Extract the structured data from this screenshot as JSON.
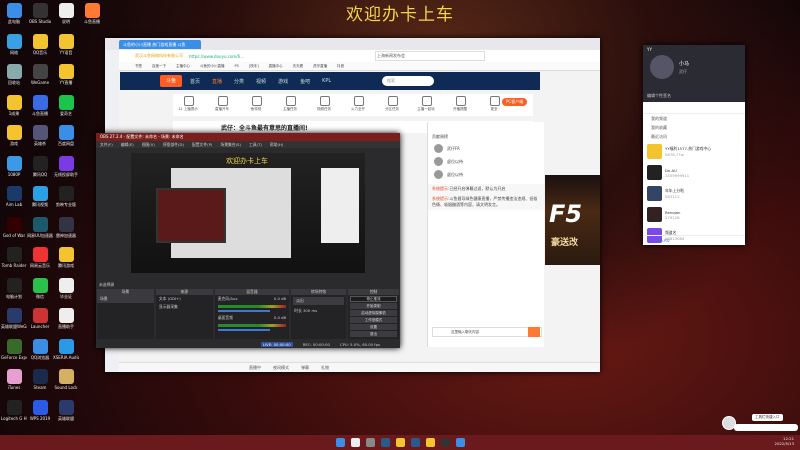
{
  "banner": "欢迎办卡上车",
  "desktop_icons": [
    {
      "label": "此电脑",
      "color": "#3a8ee6"
    },
    {
      "label": "OBS Studio",
      "color": "#333"
    },
    {
      "label": "说明",
      "color": "#eee"
    },
    {
      "label": "斗鱼直播",
      "color": "#ff7a30"
    },
    {
      "label": "网络",
      "color": "#3aa0e6"
    },
    {
      "label": "QQ音乐",
      "color": "#f4c430"
    },
    {
      "label": "YY语音",
      "color": "#f4c430"
    },
    {
      "label": "回收站",
      "color": "#8aa"
    },
    {
      "label": "WeGame",
      "color": "#444"
    },
    {
      "label": "YY直播",
      "color": "#f4c430"
    },
    {
      "label": "1成果",
      "color": "#f4c430"
    },
    {
      "label": "斗鱼直播",
      "color": "#3a6ae6"
    },
    {
      "label": "爱奇艺",
      "color": "#1bc44a"
    },
    {
      "label": "游戏",
      "color": "#f4c430"
    },
    {
      "label": "英雄杀",
      "color": "#557"
    },
    {
      "label": "百度网盘",
      "color": "#3a8ee6"
    },
    {
      "label": "1080P",
      "color": "#3a9ae6"
    },
    {
      "label": "腾讯QQ",
      "color": "#222"
    },
    {
      "label": "无线投屏助手",
      "color": "#7a3ae6"
    },
    {
      "label": "Aim Lab",
      "color": "#1a3a6a"
    },
    {
      "label": "腾讯视频",
      "color": "#2aa0e6"
    },
    {
      "label": "剪映专业版",
      "color": "#222"
    },
    {
      "label": "God of War",
      "color": "#300"
    },
    {
      "label": "网易UU加速器",
      "color": "#1a5a6a"
    },
    {
      "label": "雷神加速器",
      "color": "#334"
    },
    {
      "label": "Tomb Raider",
      "color": "#222"
    },
    {
      "label": "网易云音乐",
      "color": "#e33"
    },
    {
      "label": "腾讯游戏",
      "color": "#f4c430"
    },
    {
      "label": "电脑计划",
      "color": "#222"
    },
    {
      "label": "微信",
      "color": "#2ac04a"
    },
    {
      "label": "毕业证",
      "color": "#eee"
    },
    {
      "label": "英雄联盟WeGame版",
      "color": "#2a3a6a"
    },
    {
      "label": "Launcher",
      "color": "#c33"
    },
    {
      "label": "直播助手",
      "color": "#eee"
    },
    {
      "label": "GeForce Experience",
      "color": "#3a6a2a"
    },
    {
      "label": "QQ浏览器",
      "color": "#3a8ee6"
    },
    {
      "label": "XSERIA Audio",
      "color": "#2a9ae6"
    },
    {
      "label": "iTunes",
      "color": "#e6a0d0"
    },
    {
      "label": "Steam",
      "color": "#1a2a4a"
    },
    {
      "label": "Sound Lock",
      "color": "#d4b060"
    },
    {
      "label": "Logitech G HUB",
      "color": "#222"
    },
    {
      "label": "WPS 2019",
      "color": "#2a5ae6"
    },
    {
      "label": "英雄联盟",
      "color": "#2a3a6a"
    }
  ],
  "browser": {
    "tab": "斗鱼的小川直播 热门游戏直播 斗鱼",
    "url": "https://www.douyu.com/6...",
    "site_name": "武汉斗鱼网络科技有限公司",
    "search": "上海新闻发布会",
    "bookmarks": [
      "书签",
      "百度一下",
      "主播中心",
      "斗鱼的小川直播",
      "PS",
      "[快手]",
      "直播中心",
      "天天看",
      "虎牙直播",
      "抖音"
    ],
    "logo": "斗鱼",
    "nav": [
      "首页",
      "直播",
      "分类",
      "视频",
      "游戏",
      "鱼吧",
      "KPL"
    ],
    "search_placeholder": "搜索",
    "sub_items": [
      "12 上播提示",
      "直播开车",
      "鱼特别",
      "主播任务",
      "视频任务",
      "火力全开",
      "分区任务",
      "主播一起玩",
      "开播提醒",
      "更多"
    ],
    "pc_client": "PC客户端",
    "room_title": "武仔：全斗鱼最有意思的直播间!",
    "follow": "关注",
    "rank": [
      {
        "name": "武仔FA"
      },
      {
        "name": "虚位以待"
      },
      {
        "name": "虚位以待"
      }
    ],
    "rank_title": "贡献周榜",
    "messages": [
      {
        "tag": "系统提示:",
        "text": "已经开启弹幕过滤，默认为开启"
      },
      {
        "tag": "系统提示:",
        "text": "斗鱼倡导绿色健康直播，严禁传播违法违规、低俗色情、吸烟酗酒等内容，请文明发言。"
      }
    ],
    "send_placeholder": "这里输入聊天内容",
    "game_text": "豪送改",
    "game_big": "F5",
    "status": [
      "直播中",
      "夜间模式",
      "弹幕",
      "礼物"
    ]
  },
  "obs": {
    "title": "OBS 27.2.4 - 配置文件: 未命名 - 场景: 未命名",
    "menu": [
      "文件(F)",
      "编辑(E)",
      "视图(V)",
      "停靠部件(D)",
      "配置文件(P)",
      "场景集合(S)",
      "工具(T)",
      "帮助(H)"
    ],
    "preview_caption": "欢迎办卡上车",
    "scene_label": "未选择源",
    "docks": {
      "scenes": "场景",
      "sources": "来源",
      "mixer": "混音器",
      "transitions": "转场特效",
      "controls": "控制"
    },
    "scene_items": [
      "场景"
    ],
    "source_items": [
      "文本 (GDI+)",
      "显示器采集"
    ],
    "mixer_items": [
      {
        "name": "麦克风/Aux",
        "db": "0.0 dB"
      },
      {
        "name": "桌面音频",
        "db": "0.0 dB"
      }
    ],
    "transition": "淡出",
    "duration_label": "时长",
    "duration": "300 ms",
    "controls": [
      "停止推流",
      "开始录制",
      "启动虚拟摄像机",
      "工作室模式",
      "设置",
      "退出"
    ],
    "status": {
      "live": "LIVE: 00:00:00",
      "rec": "REC: 00:00:00",
      "cpu": "CPU: 5.0%, 60.00 fps"
    }
  },
  "yy": {
    "app": "YY",
    "name": "小马",
    "status": "武仔",
    "signature": "编辑个性签名",
    "groups": [
      "我的频道",
      "我的收藏",
      "最近访问"
    ],
    "items": [
      {
        "title": "YY福利1577-热门游戏中心",
        "sub": "5876,77w",
        "color": "#f4c430"
      },
      {
        "title": "Dn.AU",
        "sub": "1459999911",
        "color": "#222"
      },
      {
        "title": "年年上分啦",
        "sub": "583112",
        "color": "#346"
      },
      {
        "title": "Renqian",
        "sub": "279126",
        "color": "#322"
      },
      {
        "title": "频道名",
        "sub": "14813084",
        "color": "#7a4ae6"
      }
    ],
    "footer": "Dn.AU"
  },
  "notification": {
    "text": "工具栏快捷入口"
  },
  "tray": {
    "time": "12:21",
    "date": "2022/5/13"
  }
}
